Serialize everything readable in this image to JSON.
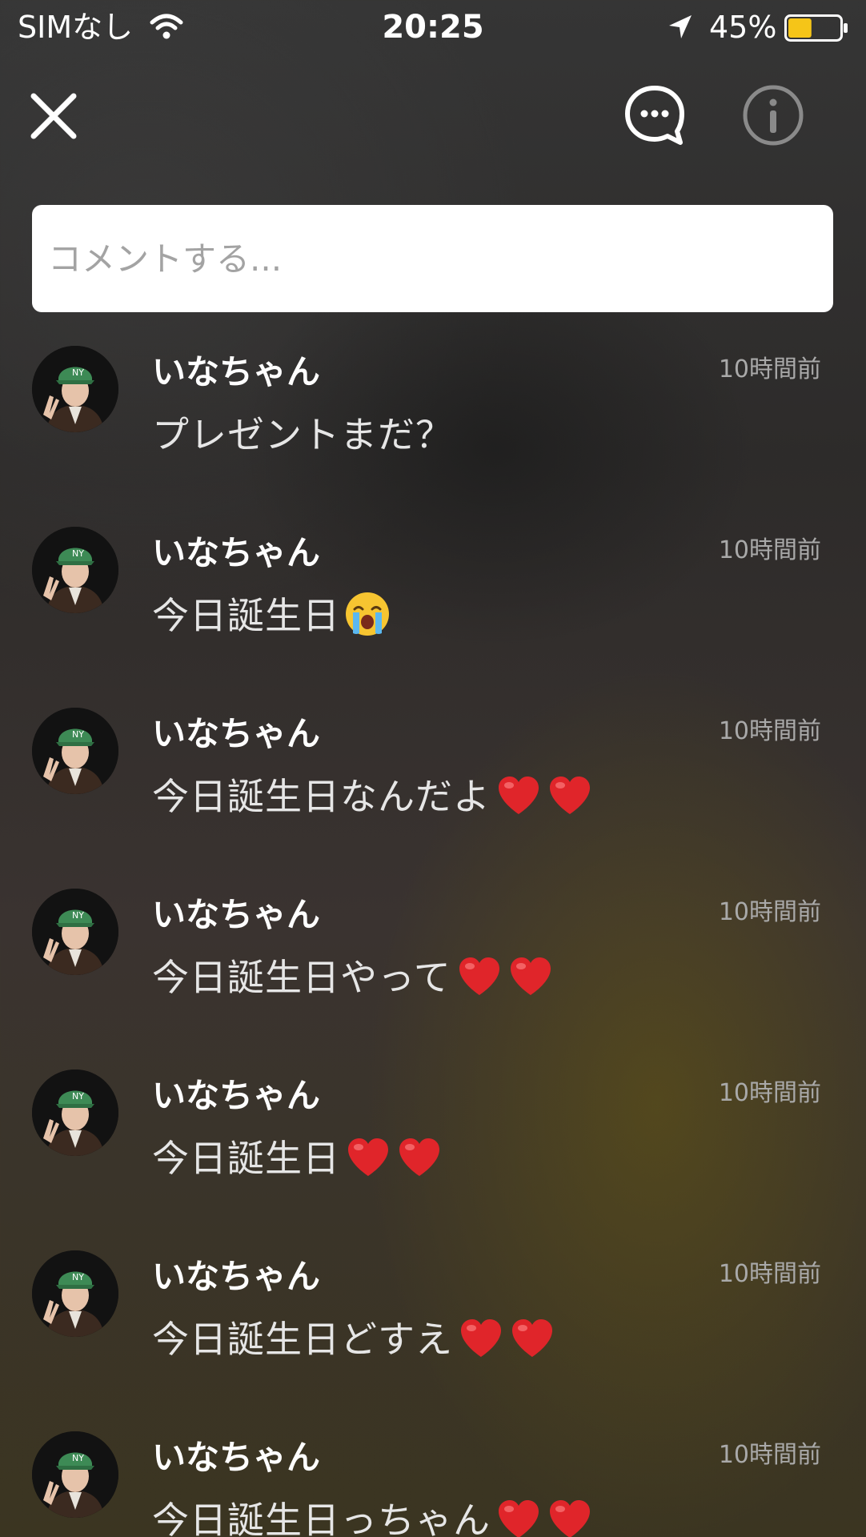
{
  "status_bar": {
    "carrier": "SIMなし",
    "time": "20:25",
    "battery_percent": "45%",
    "battery_level": 0.45,
    "battery_color": "#f5c518"
  },
  "nav": {
    "close_icon": "close-icon",
    "comments_icon": "speech-bubble-icon",
    "info_icon": "info-icon"
  },
  "comment_input": {
    "placeholder": "コメントする..."
  },
  "comments": [
    {
      "user": "いなちゃん",
      "time": "10時間前",
      "text": "プレゼントまだ？",
      "emoji": []
    },
    {
      "user": "いなちゃん",
      "time": "10時間前",
      "text": "今日誕生日",
      "emoji": [
        "crying-face"
      ]
    },
    {
      "user": "いなちゃん",
      "time": "10時間前",
      "text": "今日誕生日なんだよ",
      "emoji": [
        "heart",
        "heart"
      ]
    },
    {
      "user": "いなちゃん",
      "time": "10時間前",
      "text": "今日誕生日やって",
      "emoji": [
        "heart",
        "heart"
      ]
    },
    {
      "user": "いなちゃん",
      "time": "10時間前",
      "text": "今日誕生日",
      "emoji": [
        "heart",
        "heart"
      ]
    },
    {
      "user": "いなちゃん",
      "time": "10時間前",
      "text": "今日誕生日どすえ",
      "emoji": [
        "heart",
        "heart"
      ]
    },
    {
      "user": "いなちゃん",
      "time": "10時間前",
      "text": "今日誕生日っちゃん",
      "emoji": [
        "heart",
        "heart"
      ]
    }
  ],
  "colors": {
    "heart": "#e0252a",
    "username": "#ffffff",
    "timestamp": "#a9a9a9"
  }
}
